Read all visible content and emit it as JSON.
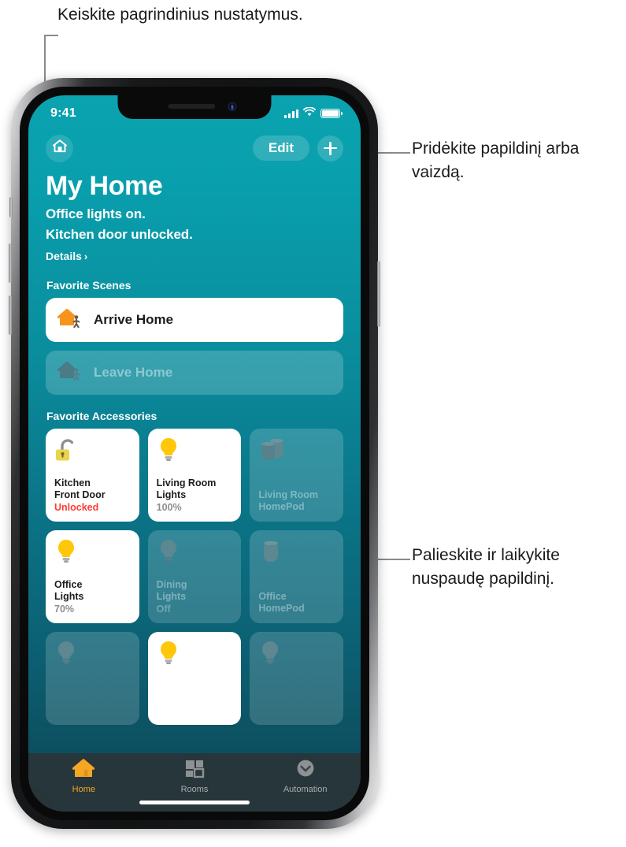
{
  "callouts": [
    {
      "id": "settings",
      "text": "Keiskite pagrindinius nustatymus."
    },
    {
      "id": "add",
      "text": "Pridėkite papildinį arba vaizdą."
    },
    {
      "id": "hold",
      "text": "Palieskite ir laikykite nuspaudę papildinį."
    }
  ],
  "status_bar": {
    "time": "9:41",
    "signal_icon": "cellular-signal-icon",
    "wifi_icon": "wifi-icon",
    "battery_icon": "battery-icon"
  },
  "nav": {
    "home_icon": "home-icon",
    "edit_label": "Edit",
    "add_icon": "plus-icon"
  },
  "header": {
    "title": "My Home",
    "status_lines": [
      "Office lights on.",
      "Kitchen door unlocked."
    ],
    "details_label": "Details",
    "details_chevron": "›"
  },
  "scenes": {
    "section_title": "Favorite Scenes",
    "items": [
      {
        "label": "Arrive Home",
        "state": "on",
        "icon": "house-walk-in-icon"
      },
      {
        "label": "Leave Home",
        "state": "off",
        "icon": "house-walk-out-icon"
      }
    ]
  },
  "accessories": {
    "section_title": "Favorite Accessories",
    "items": [
      {
        "name": "Kitchen\nFront Door",
        "state": "Unlocked",
        "on": true,
        "alert": true,
        "icon": "unlocked-padlock-icon"
      },
      {
        "name": "Living Room\nLights",
        "state": "100%",
        "on": true,
        "alert": false,
        "icon": "lightbulb-icon"
      },
      {
        "name": "Living Room\nHomePod",
        "state": "",
        "on": false,
        "alert": false,
        "icon": "homepod-pair-icon"
      },
      {
        "name": "Office\nLights",
        "state": "70%",
        "on": true,
        "alert": false,
        "icon": "lightbulb-icon"
      },
      {
        "name": "Dining\nLights",
        "state": "Off",
        "on": false,
        "alert": false,
        "icon": "lightbulb-icon"
      },
      {
        "name": "Office\nHomePod",
        "state": "",
        "on": false,
        "alert": false,
        "icon": "homepod-icon"
      },
      {
        "name": "",
        "state": "",
        "on": false,
        "alert": false,
        "icon": "lightbulb-icon"
      },
      {
        "name": "",
        "state": "",
        "on": true,
        "alert": false,
        "icon": "lightbulb-icon"
      },
      {
        "name": "",
        "state": "",
        "on": false,
        "alert": false,
        "icon": "lightbulb-icon"
      }
    ]
  },
  "tabs": [
    {
      "label": "Home",
      "icon": "home-icon",
      "active": true
    },
    {
      "label": "Rooms",
      "icon": "rooms-icon",
      "active": false
    },
    {
      "label": "Automation",
      "icon": "clock-check-icon",
      "active": false
    }
  ],
  "colors": {
    "accent_orange": "#f5a623",
    "bulb_yellow": "#ffc709",
    "alert_red": "#ff3b30",
    "bg_top": "#0ba3b0",
    "bg_bottom": "#0c4e5e"
  }
}
